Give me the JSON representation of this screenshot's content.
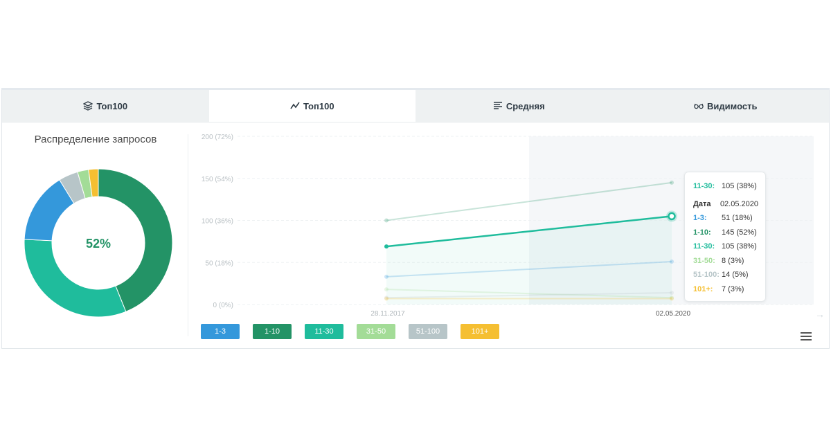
{
  "tabs": [
    {
      "label": "Топ100",
      "icon": "layers-icon",
      "active": false
    },
    {
      "label": "Топ100",
      "icon": "trend-icon",
      "active": true
    },
    {
      "label": "Средняя",
      "icon": "bars-icon",
      "active": false
    },
    {
      "label": "Видимость",
      "icon": "glasses-icon",
      "active": false
    }
  ],
  "donut": {
    "title": "Распределение запросов",
    "center_label": "52%"
  },
  "colors": {
    "1-3": "#3498db",
    "1-10": "#239366",
    "11-30": "#1fbc9c",
    "31-50": "#a3dc97",
    "51-100": "#b7c5c8",
    "101+": "#f5bf32"
  },
  "legend": [
    {
      "label": "1-3",
      "color": "#3498db"
    },
    {
      "label": "1-10",
      "color": "#239366"
    },
    {
      "label": "11-30",
      "color": "#1fbc9c"
    },
    {
      "label": "31-50",
      "color": "#a3dc97"
    },
    {
      "label": "51-100",
      "color": "#b7c5c8"
    },
    {
      "label": "101+",
      "color": "#f5bf32"
    }
  ],
  "tooltip": {
    "header_key": "11-30:",
    "header_val": "105 (38%)",
    "rows": [
      {
        "key": "Дата",
        "val": "02.05.2020",
        "color": "#333333"
      },
      {
        "key": "1-3:",
        "val": "51 (18%)",
        "color": "#3498db"
      },
      {
        "key": "1-10:",
        "val": "145 (52%)",
        "color": "#239366"
      },
      {
        "key": "11-30:",
        "val": "105 (38%)",
        "color": "#1fbc9c"
      },
      {
        "key": "31-50:",
        "val": "8 (3%)",
        "color": "#a3dc97"
      },
      {
        "key": "51-100:",
        "val": "14 (5%)",
        "color": "#b7c5c8"
      },
      {
        "key": "101+:",
        "val": "7 (3%)",
        "color": "#f5bf32"
      }
    ]
  },
  "chart_data": [
    {
      "type": "pie",
      "title": "Распределение запросов",
      "categories": [
        "1-10",
        "11-30",
        "1-3",
        "51-100",
        "31-50",
        "101+"
      ],
      "values": [
        145,
        105,
        51,
        14,
        8,
        7
      ],
      "center_label": "52%"
    },
    {
      "type": "line",
      "x": [
        "28.11.2017",
        "02.05.2020"
      ],
      "y_ticks": [
        "0 (0%)",
        "50 (18%)",
        "100 (36%)",
        "150 (54%)",
        "200 (72%)"
      ],
      "ylim": [
        0,
        200
      ],
      "grid": true,
      "series": [
        {
          "name": "1-3",
          "values": [
            33,
            51
          ],
          "color": "#3498db"
        },
        {
          "name": "1-10",
          "values": [
            100,
            145
          ],
          "color": "#239366"
        },
        {
          "name": "11-30",
          "values": [
            69,
            105
          ],
          "color": "#1fbc9c"
        },
        {
          "name": "31-50",
          "values": [
            18,
            8
          ],
          "color": "#a3dc97"
        },
        {
          "name": "51-100",
          "values": [
            8,
            14
          ],
          "color": "#b7c5c8"
        },
        {
          "name": "101+",
          "values": [
            7,
            7
          ],
          "color": "#f5bf32"
        }
      ],
      "highlighted_series": "11-30",
      "highlighted_x": "02.05.2020"
    }
  ]
}
